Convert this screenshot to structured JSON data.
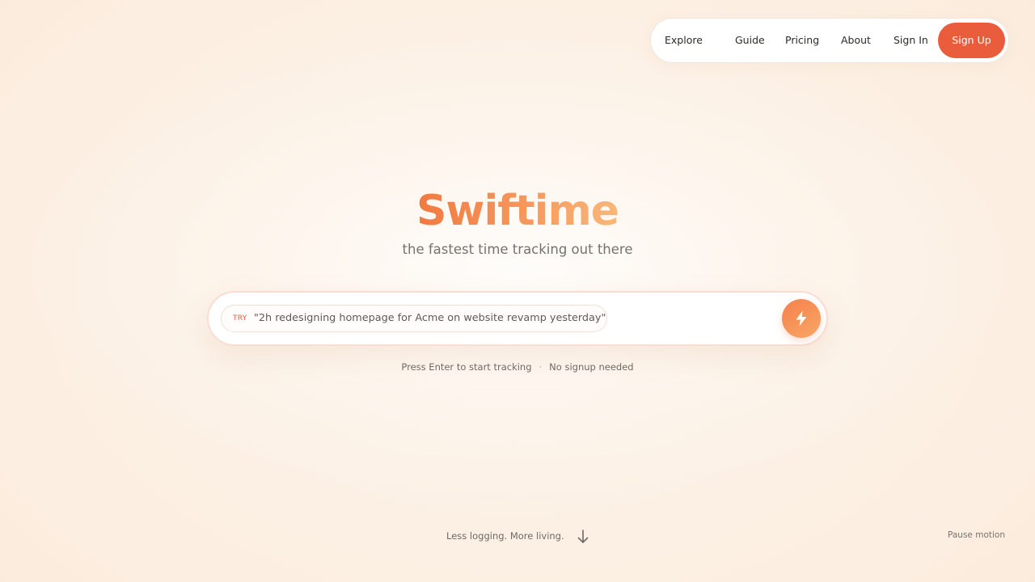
{
  "nav": {
    "explore": "Explore",
    "guide": "Guide",
    "pricing": "Pricing",
    "about": "About",
    "sign_in": "Sign In",
    "sign_up": "Sign Up"
  },
  "hero": {
    "title": "Swiftime",
    "subtitle": "the fastest time tracking out there"
  },
  "search": {
    "try_label": "TRY",
    "suggestion": "\"2h redesigning homepage for Acme on website revamp yesterday\"",
    "submit_icon": "lightning-bolt-icon"
  },
  "hint": {
    "press_enter": "Press Enter to start tracking",
    "separator": "·",
    "no_signup": "No signup needed"
  },
  "footer": {
    "tagline": "Less logging. More living.",
    "scroll_icon": "arrow-down-icon",
    "pause_motion": "Pause motion"
  },
  "colors": {
    "accent": "#ea5d3c",
    "gradient_start": "#f07a40",
    "gradient_end": "#f9b77a",
    "background": "#fdf1e4"
  }
}
